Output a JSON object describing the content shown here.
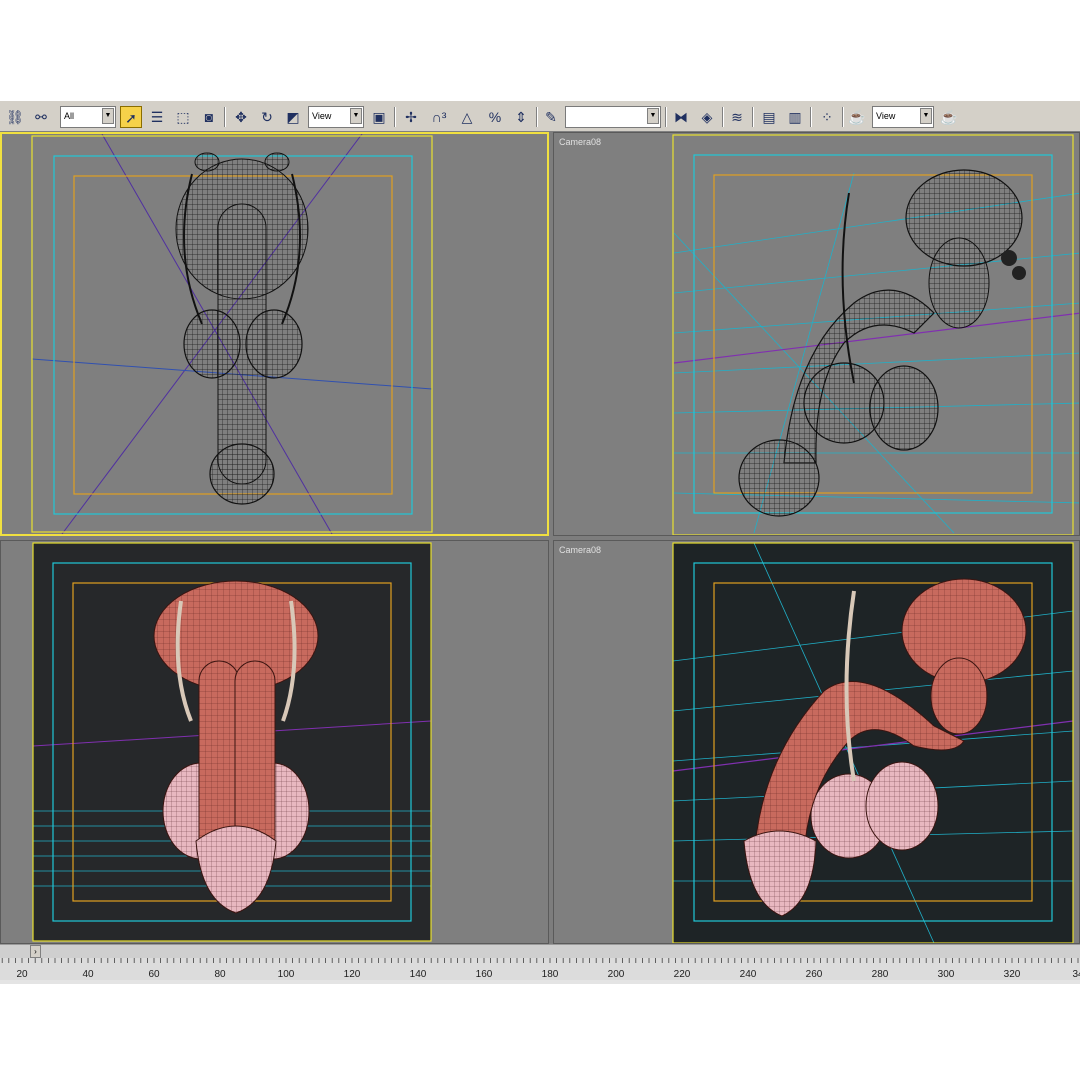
{
  "toolbar": {
    "selection_filter": "All",
    "reference_coord": "View",
    "named_selection": "",
    "render_coord": "View",
    "icons": [
      "select-link-icon",
      "unlink-icon",
      "selection-filter-dropdown",
      "select-object-icon",
      "select-by-name-icon",
      "rect-selection-icon",
      "window-crossing-icon",
      "move-icon",
      "rotate-icon",
      "scale-icon",
      "reference-coord-dropdown",
      "pivot-icon",
      "manipulate-icon",
      "snap-3d-icon",
      "angle-snap-icon",
      "percent-snap-icon",
      "spinner-snap-icon",
      "edit-named-selection-icon",
      "mirror-icon",
      "align-icon",
      "layer-manager-icon",
      "curve-editor-icon",
      "schematic-view-icon",
      "material-editor-icon",
      "render-scene-icon",
      "quick-render-icon"
    ]
  },
  "viewports": {
    "top_left": {
      "label": ""
    },
    "top_right": {
      "label": "Camera08"
    },
    "bottom_left": {
      "label": ""
    },
    "bottom_right": {
      "label": "Camera08"
    }
  },
  "timeline": {
    "ticks": [
      "20",
      "40",
      "60",
      "80",
      "100",
      "120",
      "140",
      "160",
      "180",
      "200",
      "220",
      "240",
      "260",
      "280",
      "300",
      "320",
      "34"
    ]
  },
  "colors": {
    "viewport_bg": "#7f7f7f",
    "active_border": "#f0e040",
    "safe_frame_outer": "#e8e030",
    "safe_frame_mid": "#20c8d8",
    "safe_frame_inner": "#e0a020",
    "mesh_shaded": "#c86a5e",
    "mesh_light": "#e8b8c0"
  }
}
